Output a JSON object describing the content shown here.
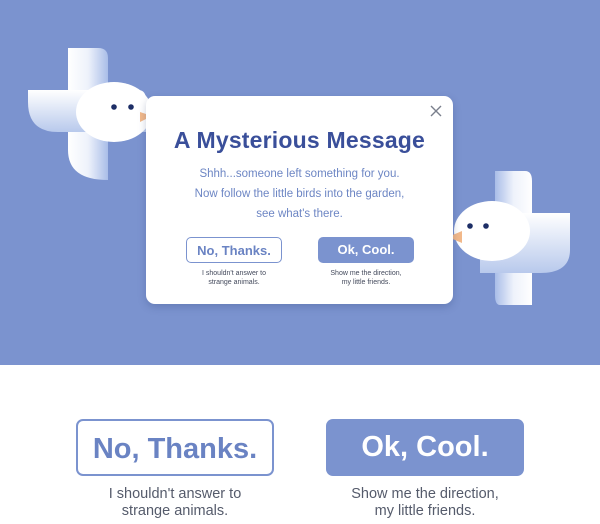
{
  "modal": {
    "title": "A Mysterious Message",
    "body_lines": [
      "Shhh...someone left something for you.",
      "Now follow the little birds into the garden,",
      "see what's there."
    ],
    "close_icon": "close-icon"
  },
  "buttons": {
    "decline_label": "No, Thanks.",
    "decline_caption": [
      "I shouldn't answer to",
      "strange animals."
    ],
    "accept_label": "Ok, Cool.",
    "accept_caption": [
      "Show me the direction,",
      "my little friends."
    ]
  },
  "icons": [
    "bird-icon",
    "close-icon"
  ],
  "colors": {
    "background": "#7b93cf",
    "title": "#3a4f9a",
    "body_text": "#6d86c4",
    "button_fill": "#7b93cf",
    "beak": "#f2b98a"
  }
}
